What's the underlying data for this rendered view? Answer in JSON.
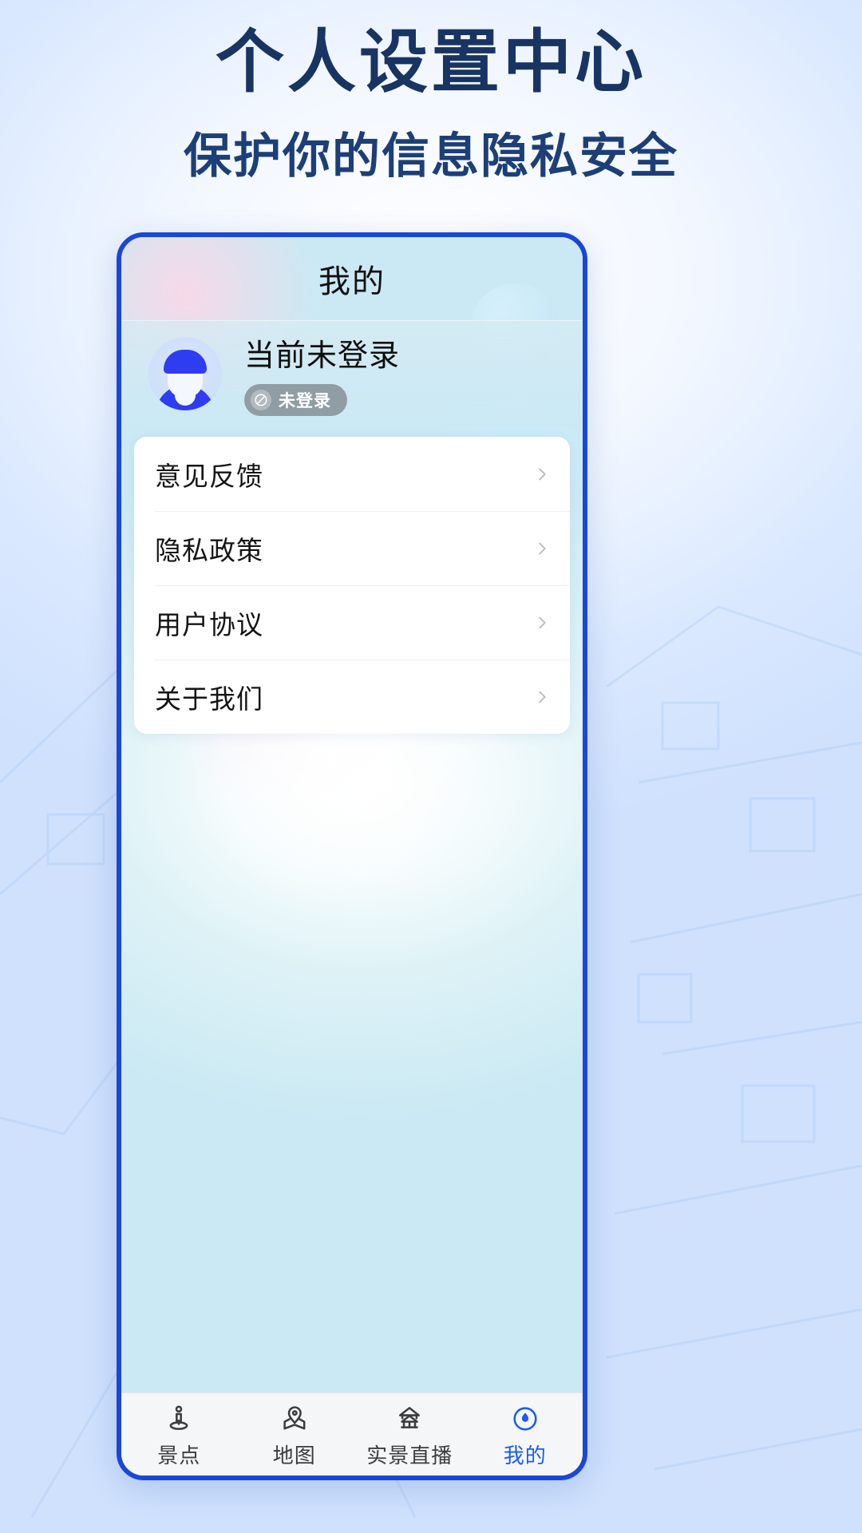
{
  "hero": {
    "title": "个人设置中心",
    "subtitle": "保护你的信息隐私安全",
    "title_color": "#183463",
    "subtitle_color": "#1d3f77"
  },
  "phone": {
    "border_color": "#1b47d6",
    "header": {
      "title": "我的"
    },
    "profile": {
      "avatar_icon": "user-avatar-icon",
      "name": "当前未登录",
      "status_badge": {
        "icon": "no-entry-icon",
        "label": "未登录",
        "background": "#7a8086",
        "text_color": "#ffffff"
      }
    },
    "menu": {
      "items": [
        {
          "label": "意见反馈",
          "chevron_icon": "chevron-right-icon"
        },
        {
          "label": "隐私政策",
          "chevron_icon": "chevron-right-icon"
        },
        {
          "label": "用户协议",
          "chevron_icon": "chevron-right-icon"
        },
        {
          "label": "关于我们",
          "chevron_icon": "chevron-right-icon"
        }
      ]
    },
    "tabbar": {
      "active_color": "#1a5cf0",
      "inactive_color": "#3c3c3c",
      "tabs": [
        {
          "label": "景点",
          "icon": "attraction-pin-icon",
          "active": false
        },
        {
          "label": "地图",
          "icon": "map-pin-icon",
          "active": false
        },
        {
          "label": "实景直播",
          "icon": "pagoda-icon",
          "active": false
        },
        {
          "label": "我的",
          "icon": "profile-droplet-icon",
          "active": true
        }
      ]
    }
  }
}
